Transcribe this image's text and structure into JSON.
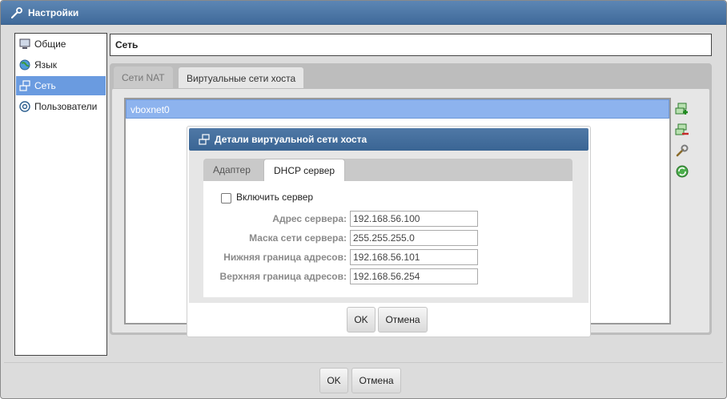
{
  "window": {
    "title": "Настройки"
  },
  "sidebar": {
    "items": [
      {
        "label": "Общие",
        "icon": "monitor-icon",
        "selected": false
      },
      {
        "label": "Язык",
        "icon": "globe-icon",
        "selected": false
      },
      {
        "label": "Сеть",
        "icon": "network-icon",
        "selected": true
      },
      {
        "label": "Пользователи",
        "icon": "at-sign-icon",
        "selected": false
      }
    ]
  },
  "section": {
    "title": "Сеть"
  },
  "tabs": [
    {
      "label": "Сети NAT",
      "active": false
    },
    {
      "label": "Виртуальные сети хоста",
      "active": true
    }
  ],
  "networks": {
    "items": [
      "vboxnet0"
    ]
  },
  "tools": [
    {
      "name": "add-network-icon"
    },
    {
      "name": "remove-network-icon"
    },
    {
      "name": "edit-network-icon"
    },
    {
      "name": "refresh-network-icon"
    }
  ],
  "dialog": {
    "title": "Детали виртуальной сети хоста",
    "tabs": [
      {
        "label": "Адаптер",
        "active": false
      },
      {
        "label": "DHCP сервер",
        "active": true
      }
    ],
    "enable_server_label": "Включить сервер",
    "enable_server_checked": false,
    "fields": [
      {
        "label": "Адрес сервера:",
        "value": "192.168.56.100"
      },
      {
        "label": "Маска сети сервера:",
        "value": "255.255.255.0"
      },
      {
        "label": "Нижняя граница адресов:",
        "value": "192.168.56.101"
      },
      {
        "label": "Верхняя граница адресов:",
        "value": "192.168.56.254"
      }
    ],
    "ok_label": "OK",
    "cancel_label": "Отмена"
  },
  "footer": {
    "ok_label": "OK",
    "cancel_label": "Отмена"
  }
}
